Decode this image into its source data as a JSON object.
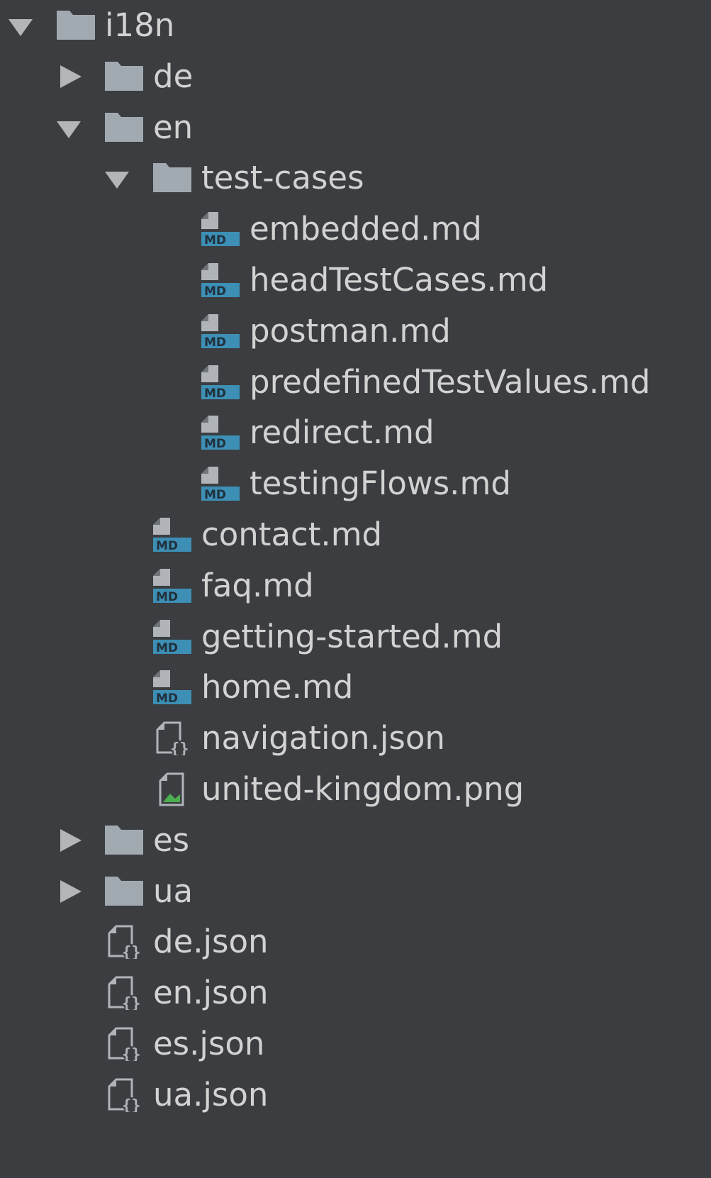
{
  "tree": [
    {
      "label": "i18n",
      "kind": "folder",
      "depth": 0,
      "expanded": true,
      "icon": "folder-icon"
    },
    {
      "label": "de",
      "kind": "folder",
      "depth": 1,
      "expanded": false,
      "icon": "folder-icon"
    },
    {
      "label": "en",
      "kind": "folder",
      "depth": 1,
      "expanded": true,
      "icon": "folder-icon"
    },
    {
      "label": "test-cases",
      "kind": "folder",
      "depth": 2,
      "expanded": true,
      "icon": "folder-icon"
    },
    {
      "label": "embedded.md",
      "kind": "file",
      "depth": 3,
      "icon": "markdown-file-icon"
    },
    {
      "label": "headTestCases.md",
      "kind": "file",
      "depth": 3,
      "icon": "markdown-file-icon"
    },
    {
      "label": "postman.md",
      "kind": "file",
      "depth": 3,
      "icon": "markdown-file-icon"
    },
    {
      "label": "predefinedTestValues.md",
      "kind": "file",
      "depth": 3,
      "icon": "markdown-file-icon"
    },
    {
      "label": "redirect.md",
      "kind": "file",
      "depth": 3,
      "icon": "markdown-file-icon"
    },
    {
      "label": "testingFlows.md",
      "kind": "file",
      "depth": 3,
      "icon": "markdown-file-icon"
    },
    {
      "label": "contact.md",
      "kind": "file",
      "depth": 2,
      "icon": "markdown-file-icon"
    },
    {
      "label": "faq.md",
      "kind": "file",
      "depth": 2,
      "icon": "markdown-file-icon"
    },
    {
      "label": "getting-started.md",
      "kind": "file",
      "depth": 2,
      "icon": "markdown-file-icon"
    },
    {
      "label": "home.md",
      "kind": "file",
      "depth": 2,
      "icon": "markdown-file-icon"
    },
    {
      "label": "navigation.json",
      "kind": "file",
      "depth": 2,
      "icon": "json-file-icon"
    },
    {
      "label": "united-kingdom.png",
      "kind": "file",
      "depth": 2,
      "icon": "image-file-icon"
    },
    {
      "label": "es",
      "kind": "folder",
      "depth": 1,
      "expanded": false,
      "icon": "folder-icon"
    },
    {
      "label": "ua",
      "kind": "folder",
      "depth": 1,
      "expanded": false,
      "icon": "folder-icon"
    },
    {
      "label": "de.json",
      "kind": "file",
      "depth": 1,
      "icon": "json-file-icon"
    },
    {
      "label": "en.json",
      "kind": "file",
      "depth": 1,
      "icon": "json-file-icon"
    },
    {
      "label": "es.json",
      "kind": "file",
      "depth": 1,
      "icon": "json-file-icon"
    },
    {
      "label": "ua.json",
      "kind": "file",
      "depth": 1,
      "icon": "json-file-icon"
    }
  ],
  "colors": {
    "background": "#3b3d40",
    "text": "#d2d2d2",
    "folder": "#a2aab1",
    "arrow": "#b3b5b7",
    "markdown_badge": "#3d8fb5",
    "file_sheet": "#b0b4b8",
    "image_green": "#4caf50"
  }
}
